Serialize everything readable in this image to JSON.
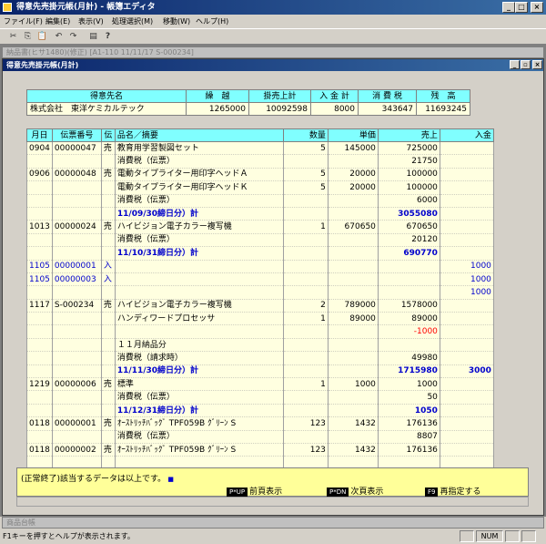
{
  "window": {
    "title": "得意先売掛元帳(月計) - 帳簿エディタ"
  },
  "menu": [
    "ファイル(F)",
    "編集(E)",
    "表示(V)",
    "処理選択(M)",
    "移動(W)",
    "ヘルプ(H)"
  ],
  "toolbar_icons": [
    "cut-icon",
    "copy-icon",
    "paste-icon",
    "undo-icon",
    "redo-icon",
    "print-icon",
    "help-icon"
  ],
  "minimized_window_1": {
    "title": "納品書(ヒサ1480)(修正) [A1-110     11/11/17 S-000234]"
  },
  "child_window": {
    "title": "得意先売掛元帳(月計)"
  },
  "header": {
    "columns": [
      "得意先名",
      "繰　越",
      "掛売上計",
      "入 金 計",
      "消 費 税",
      "残　高"
    ],
    "values": [
      "株式会社　東洋ケミカルテック",
      "1265000",
      "10092598",
      "8000",
      "343647",
      "11693245"
    ]
  },
  "ledger": {
    "columns": [
      "月日",
      "伝票番号",
      "伝",
      "品名／摘要",
      "数量",
      "単価",
      "売上",
      "入金"
    ],
    "rows": [
      {
        "d": "0904",
        "no": "00000047",
        "k": "売",
        "name": "教育用学習製図セット",
        "qty": "5",
        "price": "145000",
        "sales": "725000",
        "pay": "",
        "style": ""
      },
      {
        "d": "",
        "no": "",
        "k": "",
        "name": "消費税（伝票）",
        "qty": "",
        "price": "",
        "sales": "21750",
        "pay": "",
        "style": ""
      },
      {
        "d": "0906",
        "no": "00000048",
        "k": "売",
        "name": "電動タイプライター用印字ヘッドＡ",
        "qty": "5",
        "price": "20000",
        "sales": "100000",
        "pay": "",
        "style": ""
      },
      {
        "d": "",
        "no": "",
        "k": "",
        "name": "電動タイプライター用印字ヘッドＫ",
        "qty": "5",
        "price": "20000",
        "sales": "100000",
        "pay": "",
        "style": ""
      },
      {
        "d": "",
        "no": "",
        "k": "",
        "name": "消費税（伝票）",
        "qty": "",
        "price": "",
        "sales": "6000",
        "pay": "",
        "style": ""
      },
      {
        "d": "",
        "no": "",
        "k": "",
        "name": "11/09/30締日分）計",
        "qty": "",
        "price": "",
        "sales": "3055080",
        "pay": "",
        "style": "blue bold"
      },
      {
        "d": "1013",
        "no": "00000024",
        "k": "売",
        "name": "ハイビジョン電子カラー複写機",
        "qty": "1",
        "price": "670650",
        "sales": "670650",
        "pay": "",
        "style": ""
      },
      {
        "d": "",
        "no": "",
        "k": "",
        "name": "消費税（伝票）",
        "qty": "",
        "price": "",
        "sales": "20120",
        "pay": "",
        "style": ""
      },
      {
        "d": "",
        "no": "",
        "k": "",
        "name": "11/10/31締日分）計",
        "qty": "",
        "price": "",
        "sales": "690770",
        "pay": "",
        "style": "blue bold"
      },
      {
        "d": "1105",
        "no": "00000001",
        "k": "入",
        "name": "",
        "qty": "",
        "price": "",
        "sales": "",
        "pay": "1000",
        "style": "blue"
      },
      {
        "d": "1105",
        "no": "00000003",
        "k": "入",
        "name": "",
        "qty": "",
        "price": "",
        "sales": "",
        "pay": "1000",
        "style": "blue"
      },
      {
        "d": "",
        "no": "",
        "k": "",
        "name": "",
        "qty": "",
        "price": "",
        "sales": "",
        "pay": "1000",
        "style": "blue"
      },
      {
        "d": "1117",
        "no": "S-000234",
        "k": "売",
        "name": "ハイビジョン電子カラー複写機",
        "qty": "2",
        "price": "789000",
        "sales": "1578000",
        "pay": "",
        "style": ""
      },
      {
        "d": "",
        "no": "",
        "k": "",
        "name": "ハンディワードプロセッサ",
        "qty": "1",
        "price": "89000",
        "sales": "89000",
        "pay": "",
        "style": ""
      },
      {
        "d": "",
        "no": "",
        "k": "",
        "name": "",
        "qty": "",
        "price": "",
        "sales": "-1000",
        "pay": "",
        "style": "red"
      },
      {
        "d": "",
        "no": "",
        "k": "",
        "name": "１１月納品分",
        "qty": "",
        "price": "",
        "sales": "",
        "pay": "",
        "style": ""
      },
      {
        "d": "",
        "no": "",
        "k": "",
        "name": "消費税（請求時）",
        "qty": "",
        "price": "",
        "sales": "49980",
        "pay": "",
        "style": ""
      },
      {
        "d": "",
        "no": "",
        "k": "",
        "name": "11/11/30締日分）計",
        "qty": "",
        "price": "",
        "sales": "1715980",
        "pay": "3000",
        "style": "blue bold"
      },
      {
        "d": "1219",
        "no": "00000006",
        "k": "売",
        "name": "標準",
        "qty": "1",
        "price": "1000",
        "sales": "1000",
        "pay": "",
        "style": ""
      },
      {
        "d": "",
        "no": "",
        "k": "",
        "name": "消費税（伝票）",
        "qty": "",
        "price": "",
        "sales": "50",
        "pay": "",
        "style": ""
      },
      {
        "d": "",
        "no": "",
        "k": "",
        "name": "11/12/31締日分）計",
        "qty": "",
        "price": "",
        "sales": "1050",
        "pay": "",
        "style": "blue bold"
      },
      {
        "d": "0118",
        "no": "00000001",
        "k": "売",
        "name": "ｵｰｽﾄﾘｯﾁﾊﾞｯｸﾞ TPF059B ｸﾞﾘｰﾝ S",
        "qty": "123",
        "price": "1432",
        "sales": "176136",
        "pay": "",
        "style": ""
      },
      {
        "d": "",
        "no": "",
        "k": "",
        "name": "消費税（伝票）",
        "qty": "",
        "price": "",
        "sales": "8807",
        "pay": "",
        "style": ""
      },
      {
        "d": "0118",
        "no": "00000002",
        "k": "売",
        "name": "ｵｰｽﾄﾘｯﾁﾊﾞｯｸﾞ TPF059B ｸﾞﾘｰﾝ S",
        "qty": "123",
        "price": "1432",
        "sales": "176136",
        "pay": "",
        "style": ""
      },
      {
        "d": "",
        "no": "",
        "k": "",
        "name": "",
        "qty": "",
        "price": "",
        "sales": "",
        "pay": "",
        "style": ""
      }
    ]
  },
  "status": {
    "message": "(正常終了)該当するデータは以上です。",
    "keys": [
      {
        "key": "P*UP",
        "label": "前頁表示"
      },
      {
        "key": "P*DN",
        "label": "次頁表示"
      },
      {
        "key": "F9",
        "label": "再指定する"
      }
    ]
  },
  "minimized_window_3": {
    "title": "商品台帳"
  },
  "statusbar": {
    "hint": "F1キーを押すとヘルプが表示されます。",
    "num": "NUM"
  }
}
